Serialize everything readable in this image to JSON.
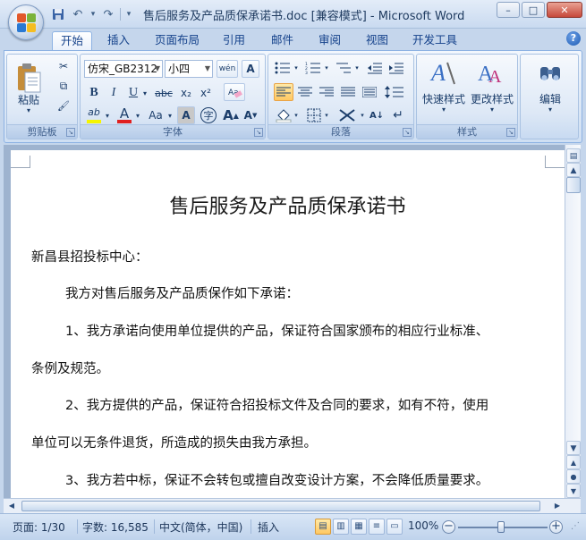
{
  "window": {
    "title": "售后服务及产品质保承诺书.doc [兼容模式] - Microsoft Word",
    "controls": {
      "minimize": "–",
      "restore": "□",
      "close": "✕"
    }
  },
  "quick_access": {
    "save_icon": "💾",
    "undo_icon": "↶",
    "redo_icon": "↷",
    "more_icon": "▾"
  },
  "tabs": [
    "开始",
    "插入",
    "页面布局",
    "引用",
    "邮件",
    "审阅",
    "视图",
    "开发工具"
  ],
  "active_tab": "开始",
  "help_label": "?",
  "ribbon": {
    "clipboard": {
      "label": "剪贴板",
      "paste_label": "粘贴",
      "cut_icon": "✂",
      "copy_icon": "⧉",
      "format_painter_icon": "🖌"
    },
    "font": {
      "label": "字体",
      "font_name": "仿宋_GB2312",
      "font_size": "小四",
      "wen_label": "wén",
      "bold": "B",
      "italic": "I",
      "underline": "U",
      "strike": "abc",
      "subscript": "x₂",
      "superscript": "x²",
      "aa_label": "Aa",
      "grow": "A",
      "shrink": "A",
      "char_border": "A",
      "highlight": "ab",
      "font_color": "A",
      "char_shading": "A",
      "enclosed": "字"
    },
    "paragraph": {
      "label": "段落",
      "sort_label": "A↓",
      "show_marks": "↵"
    },
    "styles": {
      "label": "样式",
      "quick_styles": "快速样式",
      "change_styles": "更改样式"
    },
    "editing": {
      "label": "编辑"
    }
  },
  "document": {
    "title": "售后服务及产品质保承诺书",
    "paragraphs": [
      "新昌县招投标中心：",
      "我方对售后服务及产品质保作如下承诺：",
      "1、我方承诺向使用单位提供的产品，保证符合国家颁布的相应行业标准、",
      "条例及规范。",
      "2、我方提供的产品，保证符合招投标文件及合同的要求，如有不符，使用",
      "单位可以无条件退货，所造成的损失由我方承担。",
      "3、我方若中标，保证不会转包或擅自改变设计方案，不会降低质量要求。"
    ]
  },
  "status": {
    "page": "页面: 1/30",
    "words": "字数: 16,585",
    "language": "中文(简体，中国)",
    "mode": "插入",
    "zoom": "100%"
  },
  "zoom_level": 1.0,
  "colors": {
    "accent": "#15428b",
    "highlight": "#ffc862",
    "font_color_bar": "#e02020",
    "highlight_bar": "#f5f500"
  }
}
